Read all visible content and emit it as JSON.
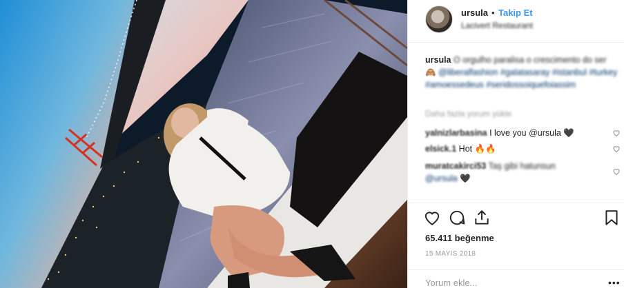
{
  "header": {
    "username": "ursula",
    "separator": "•",
    "follow_label": "Takip Et",
    "location": "Lacivert Restaurant"
  },
  "caption": {
    "username": "ursula",
    "text_blurred": "O orgulho paralisa o crescimento do ser",
    "emoji": "🙈",
    "tags": "@liberalfashion #galatasaray #istanbul #turkey #amoessedeus #seridossoiquefoiassim"
  },
  "load_more": "Daha fazla yorum yükle",
  "comments": [
    {
      "user": "yalnizlarbasina",
      "text": "I love you @ursula",
      "emoji": "🖤"
    },
    {
      "user": "elsick.1",
      "text": "Hot",
      "emoji": "🔥🔥"
    },
    {
      "user": "muratcakirci53",
      "text": "Taş gibi hatunsun",
      "text2": "@ursula",
      "emoji": "🖤"
    }
  ],
  "likes": "65.411 beğenme",
  "date": "15 MAYIS 2018",
  "comment_input": {
    "placeholder": "Yorum ekle..."
  },
  "more_label": "•••",
  "colors": {
    "link": "#3897f0",
    "text": "#262626",
    "muted": "#999999",
    "border": "#efefef"
  },
  "icons": [
    "heart-icon",
    "comment-icon",
    "share-icon",
    "bookmark-icon"
  ]
}
